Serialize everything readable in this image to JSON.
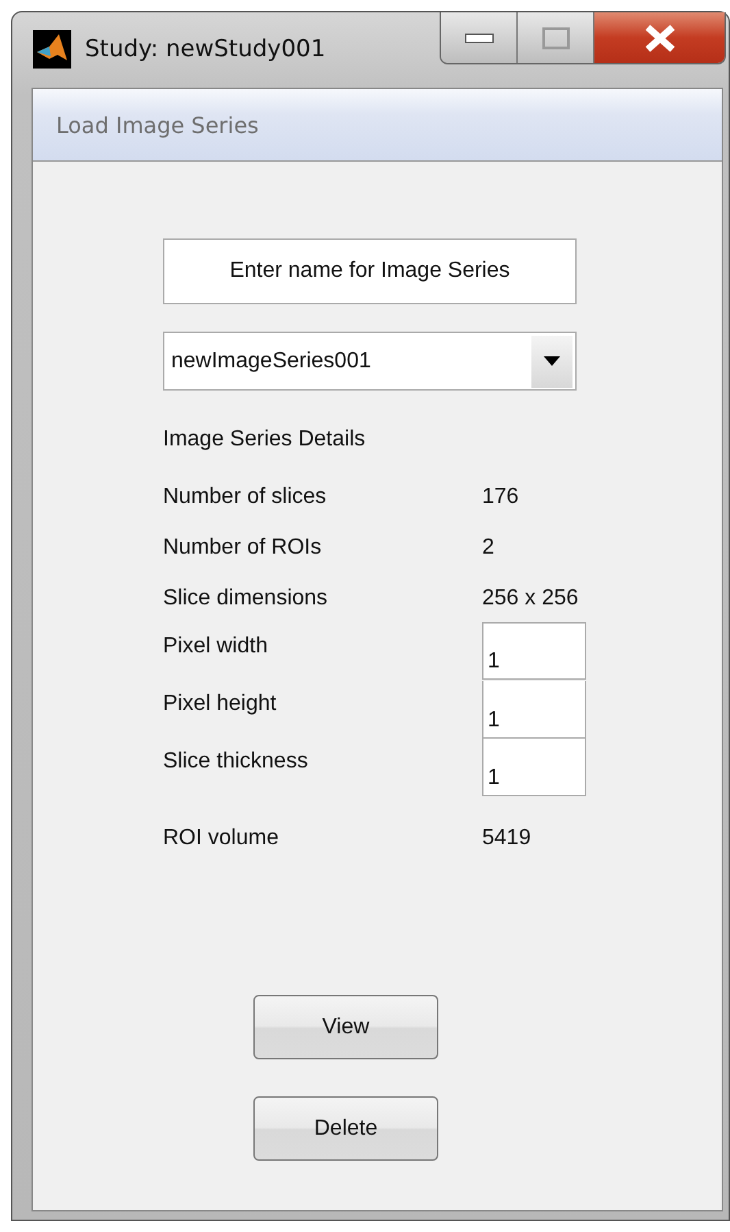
{
  "window": {
    "title": "Study: newStudy001"
  },
  "panel": {
    "title": "Load Image Series"
  },
  "name_field": {
    "value": "Enter name for Image Series"
  },
  "series_dropdown": {
    "value": "newImageSeries001"
  },
  "details_heading": "Image Series Details",
  "details": [
    {
      "kind": "text",
      "label": "Number of slices",
      "value": "176"
    },
    {
      "kind": "text",
      "label": "Number of ROIs",
      "value": "2"
    },
    {
      "kind": "text",
      "label": "Slice dimensions",
      "value": "256 x 256"
    },
    {
      "kind": "input",
      "label": "Pixel width",
      "value": "1"
    },
    {
      "kind": "input",
      "label": "Pixel height",
      "value": "1"
    },
    {
      "kind": "input",
      "label": "Slice thickness",
      "value": "1"
    },
    {
      "kind": "text",
      "label": "ROI volume",
      "value": "5419"
    }
  ],
  "buttons": [
    "View",
    "Delete"
  ]
}
